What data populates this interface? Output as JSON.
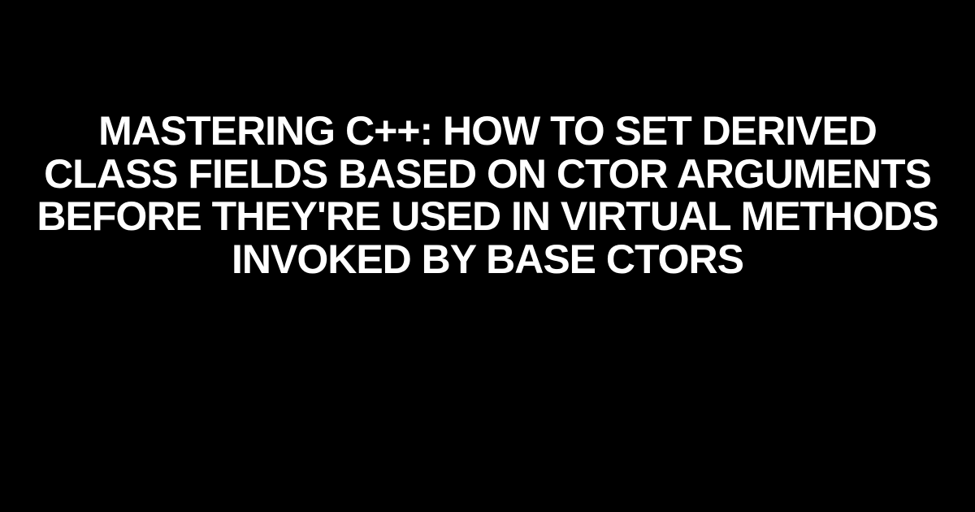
{
  "title": "Mastering C++: How to Set Derived Class Fields Based on Ctor Arguments Before They're Used in Virtual Methods Invoked by Base Ctors"
}
